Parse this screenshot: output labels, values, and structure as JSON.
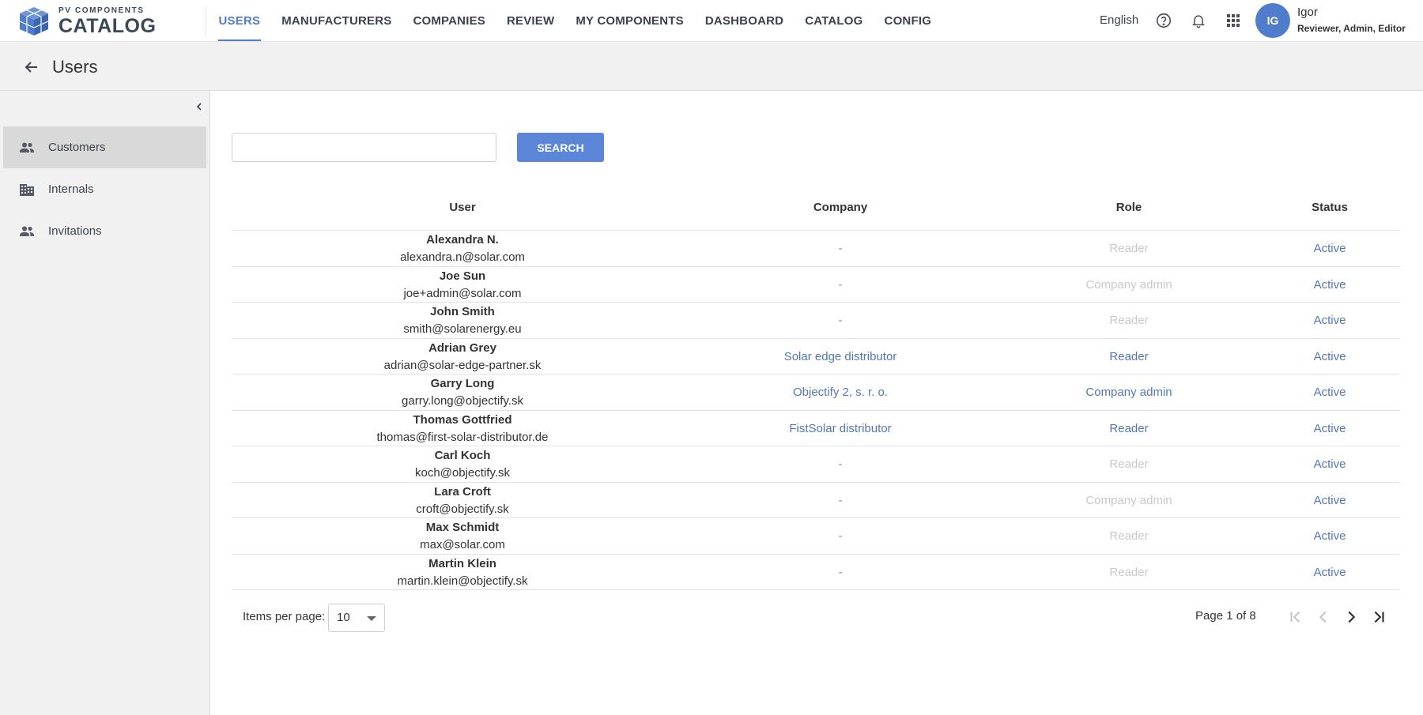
{
  "app": {
    "logo_small": "PV COMPONENTS",
    "logo_big": "CATALOG"
  },
  "nav": [
    {
      "label": "USERS",
      "active": true
    },
    {
      "label": "MANUFACTURERS"
    },
    {
      "label": "COMPANIES"
    },
    {
      "label": "REVIEW"
    },
    {
      "label": "MY COMPONENTS"
    },
    {
      "label": "DASHBOARD"
    },
    {
      "label": "CATALOG"
    },
    {
      "label": "CONFIG"
    }
  ],
  "topbar": {
    "language": "English",
    "avatar_initials": "IG",
    "user_name": "Igor",
    "user_roles": "Reviewer, Admin, Editor",
    "icons": [
      "help-circle-icon",
      "bell-icon",
      "apps-grid-icon"
    ]
  },
  "header": {
    "title": "Users"
  },
  "sidebar": {
    "items": [
      {
        "label": "Customers",
        "icon": "people-icon",
        "active": true
      },
      {
        "label": "Internals",
        "icon": "building-icon"
      },
      {
        "label": "Invitations",
        "icon": "people-icon"
      }
    ]
  },
  "search": {
    "value": "",
    "placeholder": "",
    "button_label": "SEARCH"
  },
  "table": {
    "headers": {
      "user": "User",
      "company": "Company",
      "role": "Role",
      "status": "Status"
    },
    "rows": [
      {
        "name": "Alexandra N.",
        "email": "alexandra.n@solar.com",
        "company": "-",
        "role": "Reader",
        "role_dim": true,
        "status": "Active"
      },
      {
        "name": "Joe Sun",
        "email": "joe+admin@solar.com",
        "company": "-",
        "role": "Company admin",
        "role_dim": true,
        "status": "Active"
      },
      {
        "name": "John Smith",
        "email": "smith@solarenergy.eu",
        "company": "-",
        "role": "Reader",
        "role_dim": true,
        "status": "Active"
      },
      {
        "name": "Adrian Grey",
        "email": "adrian@solar-edge-partner.sk",
        "company": "Solar edge distributor",
        "role": "Reader",
        "role_dim": false,
        "status": "Active"
      },
      {
        "name": "Garry Long",
        "email": "garry.long@objectify.sk",
        "company": "Objectify 2, s. r. o.",
        "role": "Company admin",
        "role_dim": false,
        "status": "Active"
      },
      {
        "name": "Thomas Gottfried",
        "email": "thomas@first-solar-distributor.de",
        "company": "FistSolar distributor",
        "role": "Reader",
        "role_dim": false,
        "status": "Active"
      },
      {
        "name": "Carl Koch",
        "email": "koch@objectify.sk",
        "company": "-",
        "role": "Reader",
        "role_dim": true,
        "status": "Active"
      },
      {
        "name": "Lara Croft",
        "email": "croft@objectify.sk",
        "company": "-",
        "role": "Company admin",
        "role_dim": true,
        "status": "Active"
      },
      {
        "name": "Max Schmidt",
        "email": "max@solar.com",
        "company": "-",
        "role": "Reader",
        "role_dim": true,
        "status": "Active"
      },
      {
        "name": "Martin Klein",
        "email": "martin.klein@objectify.sk",
        "company": "-",
        "role": "Reader",
        "role_dim": true,
        "status": "Active"
      }
    ]
  },
  "pagination": {
    "items_per_page_label": "Items per page:",
    "items_per_page_value": "10",
    "page_info": "Page 1 of 8",
    "current_page": 1,
    "total_pages": 8
  },
  "colors": {
    "accent": "#4f7dcc",
    "button": "#5b86d8",
    "link": "#5377b6",
    "dim_text": "#c9c9c9",
    "panel_bg": "#f1f1f2"
  }
}
